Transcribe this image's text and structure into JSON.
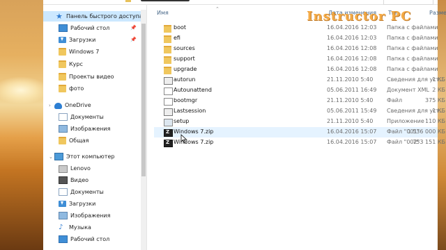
{
  "address": {
    "search_placeholder": ""
  },
  "columns": {
    "name": "Имя",
    "date": "Дата изменения",
    "type": "Тип",
    "size": "Размер"
  },
  "nav": [
    {
      "label": "Панель быстрого доступа",
      "icon": "star-icon",
      "pinned": false,
      "selected": true
    },
    {
      "label": "Рабочий стол",
      "icon": "desktop-icon",
      "pinned": true
    },
    {
      "label": "Загрузки",
      "icon": "download-icon",
      "pinned": true
    },
    {
      "label": "Windows 7",
      "icon": "folder-icon"
    },
    {
      "label": "Курс",
      "icon": "folder-icon"
    },
    {
      "label": "Проекты видео",
      "icon": "folder-icon"
    },
    {
      "label": "фото",
      "icon": "folder-icon"
    },
    {
      "label": "OneDrive",
      "icon": "cloud-icon"
    },
    {
      "label": "Документы",
      "icon": "documents-icon"
    },
    {
      "label": "Изображения",
      "icon": "pictures-icon"
    },
    {
      "label": "Общая",
      "icon": "folder-icon"
    },
    {
      "label": "Этот компьютер",
      "icon": "computer-icon"
    },
    {
      "label": "Lenovo",
      "icon": "drive-icon"
    },
    {
      "label": "Видео",
      "icon": "video-icon"
    },
    {
      "label": "Документы",
      "icon": "documents-icon"
    },
    {
      "label": "Загрузки",
      "icon": "download-icon"
    },
    {
      "label": "Изображения",
      "icon": "pictures-icon"
    },
    {
      "label": "Музыка",
      "icon": "music-icon"
    },
    {
      "label": "Рабочий стол",
      "icon": "desktop-icon"
    }
  ],
  "files": [
    {
      "name": "boot",
      "date": "16.04.2016 12:03",
      "type": "Папка с файлами",
      "size": "",
      "icon": "folder-icon"
    },
    {
      "name": "efi",
      "date": "16.04.2016 12:03",
      "type": "Папка с файлами",
      "size": "",
      "icon": "folder-icon"
    },
    {
      "name": "sources",
      "date": "16.04.2016 12:08",
      "type": "Папка с файлами",
      "size": "",
      "icon": "folder-icon"
    },
    {
      "name": "support",
      "date": "16.04.2016 12:08",
      "type": "Папка с файлами",
      "size": "",
      "icon": "folder-icon"
    },
    {
      "name": "upgrade",
      "date": "16.04.2016 12:08",
      "type": "Папка с файлами",
      "size": "",
      "icon": "folder-icon"
    },
    {
      "name": "autorun",
      "date": "21.11.2010 5:40",
      "type": "Сведения для уст...",
      "size": "1 КБ",
      "icon": "settings-file-icon"
    },
    {
      "name": "Autounattend",
      "date": "05.06.2011 16:49",
      "type": "Документ XML",
      "size": "2 КБ",
      "icon": "xml-file-icon"
    },
    {
      "name": "bootmgr",
      "date": "21.11.2010 5:40",
      "type": "Файл",
      "size": "375 КБ",
      "icon": "file-icon"
    },
    {
      "name": "Lastsession",
      "date": "05.06.2011 15:49",
      "type": "Сведения для уст...",
      "size": "1 КБ",
      "icon": "settings-file-icon"
    },
    {
      "name": "setup",
      "date": "21.11.2010 5:40",
      "type": "Приложение",
      "size": "110 КБ",
      "icon": "setup-icon"
    },
    {
      "name": "Windows 7.zip",
      "date": "16.04.2016 15:07",
      "type": "Файл \"001\"",
      "size": "1 536 000 КБ",
      "icon": "zip-icon",
      "hover": true
    },
    {
      "name": "Windows 7.zip",
      "date": "16.04.2016 15:07",
      "type": "Файл \"002\"",
      "size": "753 151 КБ",
      "icon": "zip-icon"
    }
  ],
  "watermark": "Instructor PC",
  "colors": {
    "selection": "#cce8ff",
    "hover": "#e5f3ff",
    "folder": "#f0c75e",
    "header_text": "#4a6a8a",
    "watermark": "#f4a232"
  }
}
